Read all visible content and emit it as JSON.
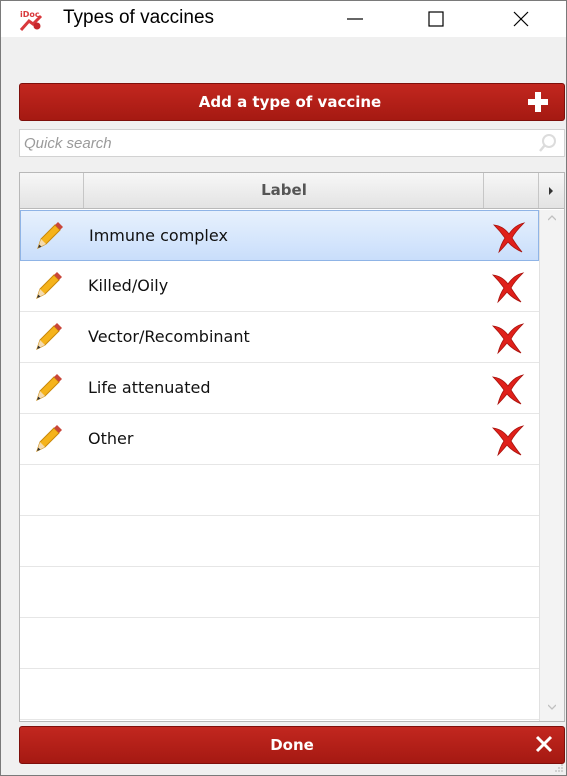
{
  "window": {
    "title": "Types of vaccines",
    "app_icon": "idoc-app-icon",
    "controls": [
      "minimize-icon",
      "maximize-icon",
      "close-icon"
    ]
  },
  "toolbar": {
    "add_label": "Add a type of vaccine",
    "add_icon": "plus-icon"
  },
  "search": {
    "placeholder": "Quick search",
    "value": "",
    "icon": "search-icon"
  },
  "table": {
    "columns": [
      "",
      "Label",
      ""
    ],
    "selected_index": 0,
    "rows": [
      {
        "label": "Immune complex",
        "edit_icon": "pencil-icon",
        "delete_icon": "delete-icon"
      },
      {
        "label": "Killed/Oily",
        "edit_icon": "pencil-icon",
        "delete_icon": "delete-icon"
      },
      {
        "label": "Vector/Recombinant",
        "edit_icon": "pencil-icon",
        "delete_icon": "delete-icon"
      },
      {
        "label": "Life attenuated",
        "edit_icon": "pencil-icon",
        "delete_icon": "delete-icon"
      },
      {
        "label": "Other",
        "edit_icon": "pencil-icon",
        "delete_icon": "delete-icon"
      }
    ]
  },
  "footer": {
    "done_label": "Done",
    "done_icon": "close-x-icon"
  },
  "colors": {
    "button_red": "#b3201a",
    "selection_blue": "#d6e7fc",
    "delete_red": "#e0201a",
    "pencil_yellow": "#f5b31b"
  }
}
